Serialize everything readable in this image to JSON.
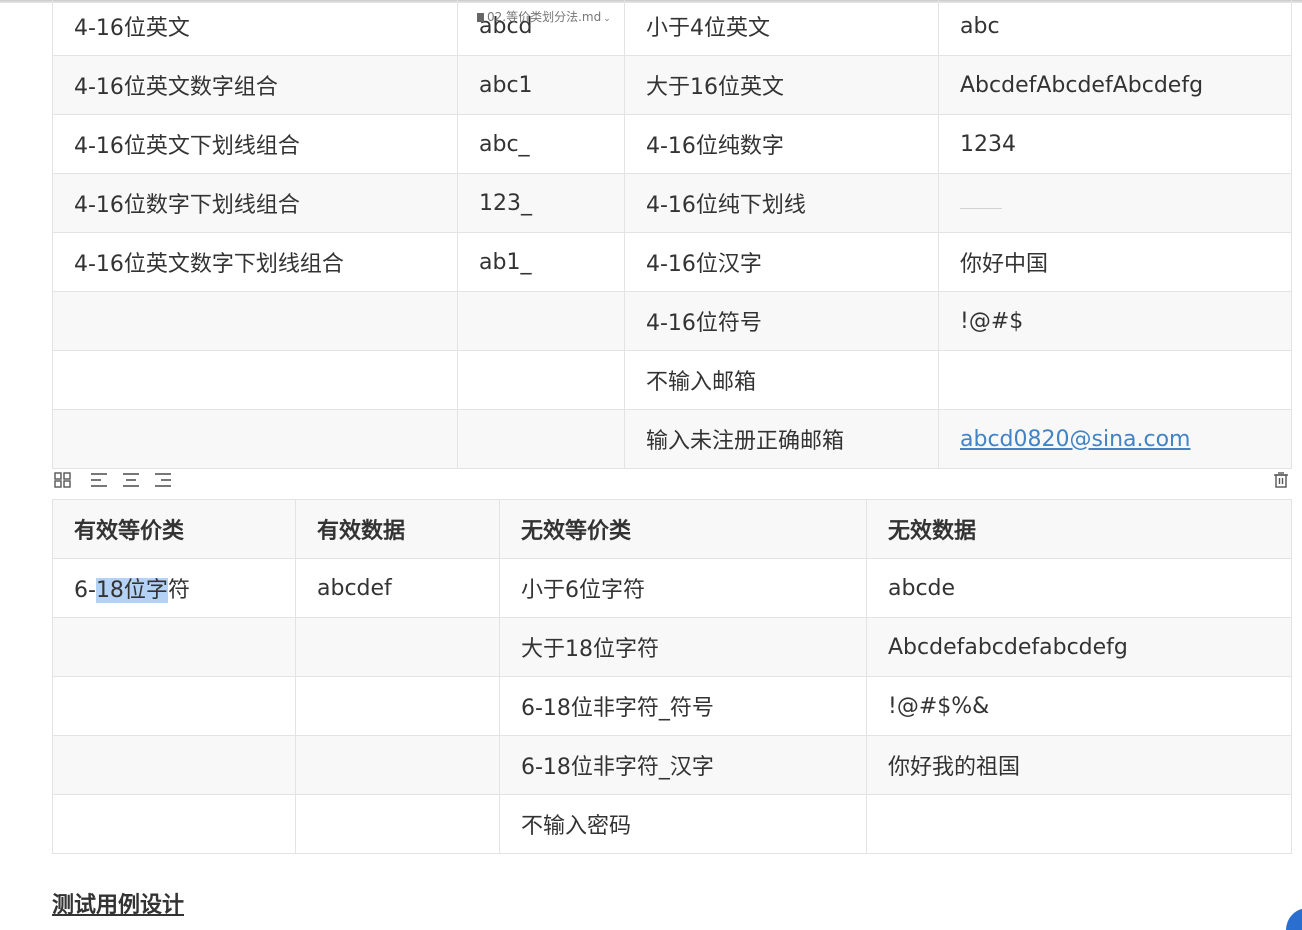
{
  "file": {
    "name": "02.等价类划分法.md"
  },
  "table1": {
    "rows": [
      [
        "4-16位英文",
        "abcd",
        "小于4位英文",
        "abc"
      ],
      [
        "4-16位英文数字组合",
        "abc1",
        "大于16位英文",
        "AbcdefAbcdefAbcdefg"
      ],
      [
        "4-16位英文下划线组合",
        "abc_",
        "4-16位纯数字",
        "1234"
      ],
      [
        "4-16位数字下划线组合",
        "123_",
        "4-16位纯下划线",
        ""
      ],
      [
        "4-16位英文数字下划线组合",
        "ab1_",
        "4-16位汉字",
        "你好中国"
      ],
      [
        "",
        "",
        "4-16位符号",
        "!@#$"
      ],
      [
        "",
        "",
        "不输入邮箱",
        ""
      ],
      [
        "",
        "",
        "输入未注册正确邮箱",
        "abcd0820@sina.com"
      ]
    ]
  },
  "toolbar": {
    "icons": [
      "table-grid-icon",
      "align-left-icon",
      "align-center-icon",
      "align-right-icon",
      "trash-icon"
    ]
  },
  "table2": {
    "headers": [
      "有效等价类",
      "有效数据",
      "无效等价类",
      "无效数据"
    ],
    "first_cell": {
      "pre": "6-",
      "selected": "18位字",
      "post": "符"
    },
    "rows": [
      [
        "6-18位字符",
        "abcdef",
        "小于6位字符",
        "abcde"
      ],
      [
        "",
        "",
        "大于18位字符",
        "Abcdefabcdefabcdefg"
      ],
      [
        "",
        "",
        "6-18位非字符_符号",
        "!@#$%&"
      ],
      [
        "",
        "",
        "6-18位非字符_汉字",
        "你好我的祖国"
      ],
      [
        "",
        "",
        "不输入密码",
        ""
      ]
    ]
  },
  "heading": {
    "text": "测试用例设计"
  },
  "colors": {
    "link": "#4183c4",
    "selection": "#b4d2f5",
    "border": "#e3e3e3",
    "stripe": "#f8f8f8"
  }
}
